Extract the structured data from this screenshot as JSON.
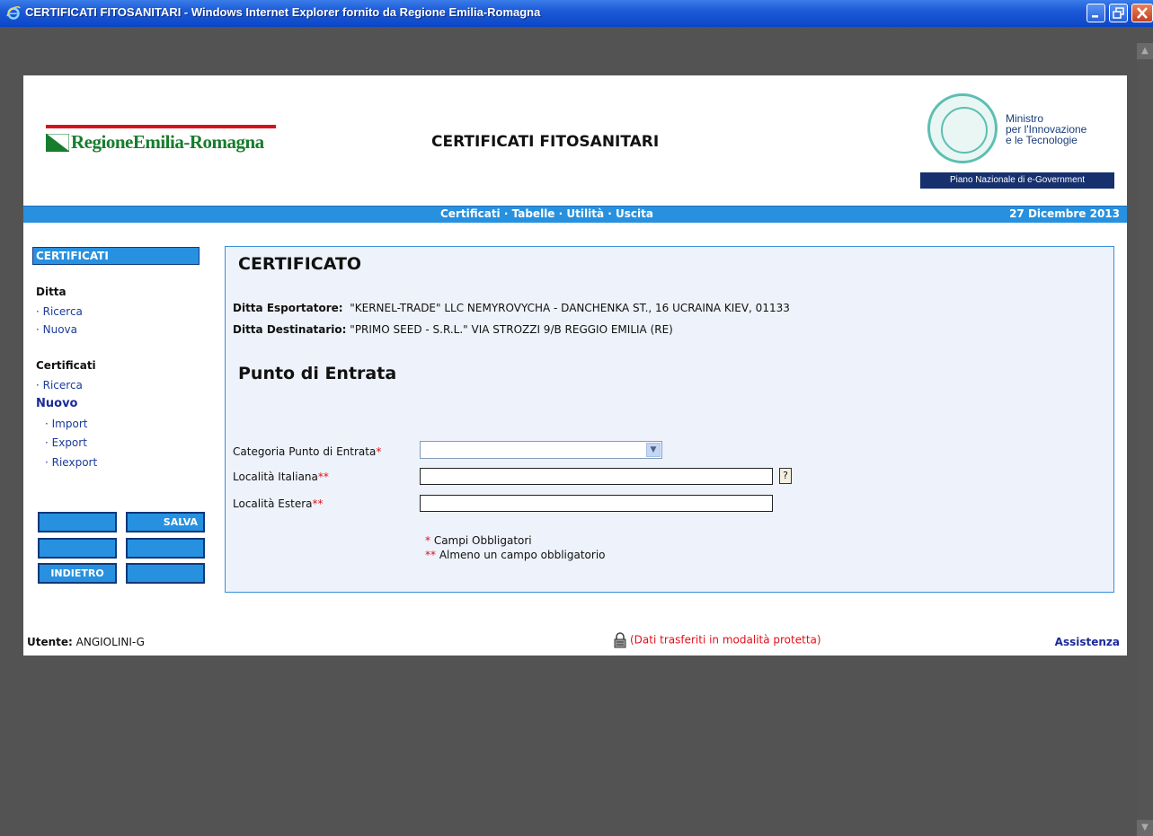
{
  "window": {
    "title": "CERTIFICATI FITOSANITARI - Windows Internet Explorer fornito da Regione Emilia-Romagna"
  },
  "header": {
    "logo_text": "RegioneEmilia-Romagna",
    "app_title": "CERTIFICATI FITOSANITARI",
    "ministro_lines": [
      "Ministro",
      "per l'Innovazione",
      "e le Tecnologie"
    ],
    "ministro_banner": "Piano Nazionale di e-Government"
  },
  "topnav": {
    "items": [
      "Certificati",
      "Tabelle",
      "Utilità",
      "Uscita"
    ],
    "separator": "·",
    "date": "27 Dicembre 2013"
  },
  "sidebar": {
    "header": "CERTIFICATI",
    "ditta_title": "Ditta",
    "ditta_items": [
      "· Ricerca",
      "· Nuova"
    ],
    "cert_title": "Certificati",
    "cert_items": [
      "· Ricerca"
    ],
    "nuovo": "Nuovo",
    "nuovo_items": [
      "· Import",
      "· Export",
      "· Riexport"
    ],
    "buttons": {
      "salva": "SALVA",
      "indietro": "INDIETRO"
    }
  },
  "main": {
    "title": "CERTIFICATO",
    "esportatore_label": "Ditta Esportatore:",
    "esportatore_value": "\"KERNEL-TRADE\" LLC NEMYROVYCHA - DANCHENKA ST., 16 UCRAINA KIEV, 01133",
    "destinatario_label": "Ditta Destinatario:",
    "destinatario_value": "\"PRIMO SEED - S.R.L.\" VIA STROZZI 9/B REGGIO EMILIA (RE)",
    "section_title": "Punto di Entrata",
    "fields": {
      "categoria_label": "Categoria Punto di Entrata",
      "categoria_value": "",
      "italiana_label": "Località Italiana",
      "italiana_value": "",
      "estera_label": "Località Estera",
      "estera_value": "",
      "help": "?"
    },
    "legend": {
      "single": "*",
      "double": "**",
      "single_text": " Campi Obbligatori",
      "double_text": " Almeno un campo obbligatorio"
    }
  },
  "footer": {
    "user_label": "Utente:",
    "user_value": " ANGIOLINI-G",
    "secure_text": "(Dati trasferiti in modalità protetta)",
    "assistenza": "Assistenza"
  }
}
